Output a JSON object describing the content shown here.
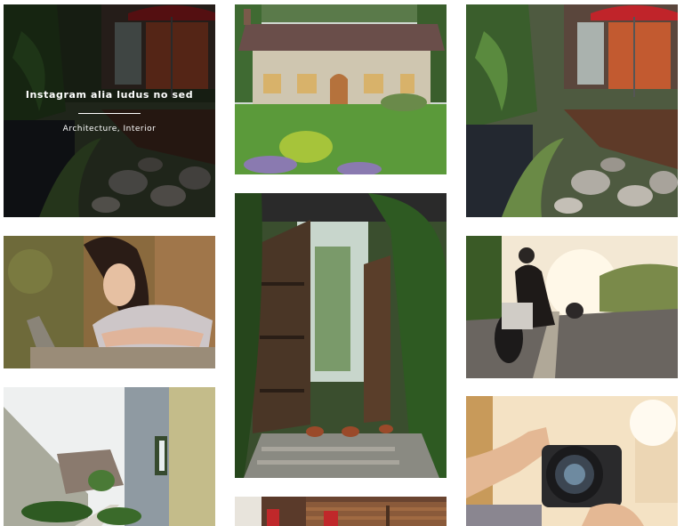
{
  "gallery": {
    "hover_item": {
      "title": "Instagram alia ludus no sed",
      "categories": "Architecture, Interior"
    },
    "items": [
      {
        "name": "garden-patio-photo",
        "subject": "patio garden with rocks and red umbrella"
      },
      {
        "name": "cottage-photo",
        "subject": "stone cottage with lawn"
      },
      {
        "name": "garden-patio-photo-2",
        "subject": "patio garden with rocks and red umbrella"
      },
      {
        "name": "woman-portrait-photo",
        "subject": "woman leaning on a log"
      },
      {
        "name": "garden-gate-photo",
        "subject": "open wooden gate to garden path"
      },
      {
        "name": "motorcycle-photo",
        "subject": "motorcyclist on road at sunset"
      },
      {
        "name": "modern-building-photo",
        "subject": "modern house with side walkway"
      },
      {
        "name": "photographer-photo",
        "subject": "person holding a camera"
      },
      {
        "name": "deck-photo",
        "subject": "wooden deck with red chairs"
      }
    ]
  },
  "colors": {
    "overlay": "#000000",
    "overlay_text": "#ffffff",
    "background": "#ffffff"
  }
}
